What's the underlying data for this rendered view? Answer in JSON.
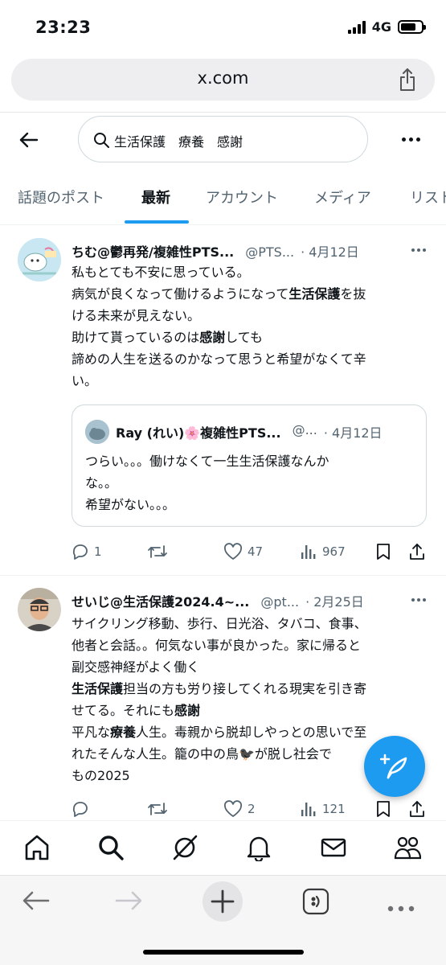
{
  "status_bar": {
    "time": "23:23",
    "network": "4G",
    "battery_level": 0.75
  },
  "browser": {
    "url": "x.com"
  },
  "search": {
    "query": "生活保護　療養　感謝"
  },
  "tabs": [
    {
      "label": "話題のポスト",
      "active": false
    },
    {
      "label": "最新",
      "active": true
    },
    {
      "label": "アカウント",
      "active": false
    },
    {
      "label": "メディア",
      "active": false
    },
    {
      "label": "リスト",
      "active": false
    }
  ],
  "tweets": [
    {
      "author": "ちむ@鬱再発/複雑性PTS...",
      "handle": "@PTS...",
      "date": "· 4月12日",
      "lines": [
        [
          {
            "t": "私もとても不安に思っている。"
          }
        ],
        [
          {
            "t": "病気が良くなって働けるようになって"
          },
          {
            "t": "生活保護",
            "b": true
          },
          {
            "t": "を抜"
          }
        ],
        [
          {
            "t": "ける未来が見えない。"
          }
        ],
        [
          {
            "t": "助けて貰っているのは"
          },
          {
            "t": "感謝",
            "b": true
          },
          {
            "t": "しても"
          }
        ],
        [
          {
            "t": "諦めの人生を送るのかなって思うと希望がなくて辛"
          }
        ],
        [
          {
            "t": "い。"
          }
        ]
      ],
      "quote": {
        "author": "Ray (れい)🌸複雑性PTS...",
        "handle": "@...",
        "date": "· 4月12日",
        "lines": [
          "つらい。。。働けなくて一生生活保護なんか",
          "な。。",
          "希望がない。。。"
        ]
      },
      "replies": "1",
      "reposts": "",
      "likes": "47",
      "views": "967"
    },
    {
      "author": "せいじ@生活保護2024.4~...",
      "handle": "@pt...",
      "date": "· 2月25日",
      "lines": [
        [
          {
            "t": "サイクリング移動、歩行、日光浴、タバコ、食事、"
          }
        ],
        [
          {
            "t": "他者と会話。。何気ない事が良かった。家に帰ると"
          }
        ],
        [
          {
            "t": "副交感神経がよく働く"
          }
        ],
        [
          {
            "t": "生活保護",
            "b": true
          },
          {
            "t": "担当の方も労り接してくれる現実を引き寄"
          }
        ],
        [
          {
            "t": "せてる。それにも"
          },
          {
            "t": "感謝",
            "b": true
          }
        ],
        [
          {
            "t": "平凡な"
          },
          {
            "t": "療養",
            "b": true
          },
          {
            "t": "人生。毒親から脱却しやっとの思いで至"
          }
        ],
        [
          {
            "t": "れたそんな人生。籠の中の鳥🐦‍⬛が脱し社会で"
          }
        ],
        [
          {
            "t": "もの2025"
          }
        ]
      ],
      "replies": "",
      "reposts": "",
      "likes": "2",
      "views": "121"
    }
  ],
  "icons": {
    "status": [
      "signal-icon",
      "battery-icon"
    ],
    "header": [
      "back-arrow-icon",
      "search-icon",
      "more-icon",
      "share-icon"
    ],
    "actions": [
      "reply-icon",
      "repost-icon",
      "like-icon",
      "views-icon",
      "bookmark-icon",
      "share-icon"
    ],
    "bottom_nav": [
      "home-icon",
      "search-icon",
      "grok-icon",
      "notifications-icon",
      "messages-icon",
      "communities-icon"
    ],
    "browser_toolbar": [
      "back-icon",
      "forward-icon",
      "new-tab-icon",
      "tabs-icon",
      "more-icon"
    ]
  },
  "colors": {
    "accent": "#1d9bf0",
    "text": "#0f1419",
    "secondary_text": "#536471"
  }
}
